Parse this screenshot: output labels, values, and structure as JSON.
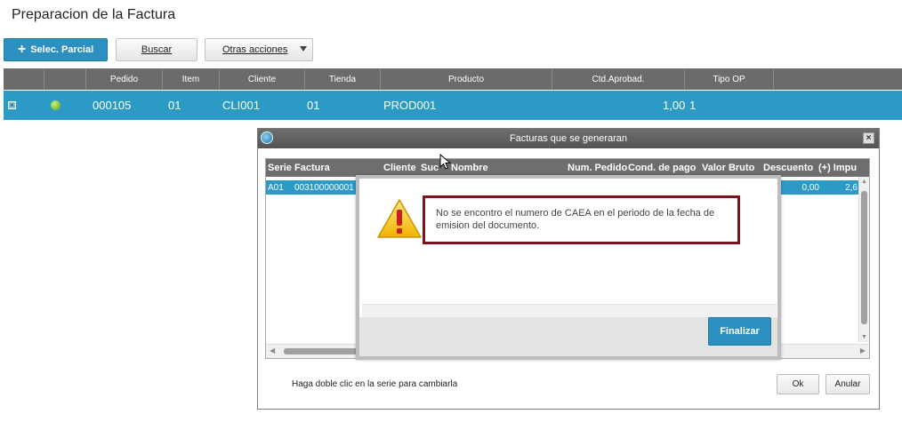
{
  "page": {
    "title": "Preparacion de la Factura"
  },
  "toolbar": {
    "selec_parcial": "Selec. Parcial",
    "buscar": "Buscar",
    "otras_acciones": "Otras acciones"
  },
  "main_grid": {
    "columns": [
      "Pedido",
      "Item",
      "Cliente",
      "Tienda",
      "Producto",
      "Ctd.Aprobad.",
      "Tipo OP"
    ],
    "row": {
      "pedido": "000105",
      "item": "01",
      "cliente": "CLI001",
      "tienda": "01",
      "producto": "PROD001",
      "ctd_aprobada": "1,00",
      "tipo_op": "1"
    }
  },
  "invoice_dialog": {
    "title": "Facturas que se generaran",
    "columns": [
      "Serie",
      "Factura",
      "Cliente",
      "Suc",
      "Nombre",
      "Num. Pedido",
      "Cond. de pago",
      "Valor Bruto",
      "Descuento",
      "(+) Impu"
    ],
    "row": {
      "serie": "A01",
      "factura": "003100000001",
      "descuento": "0,00",
      "impuesto": "2,6"
    },
    "hint": "Haga doble clic en la serie para cambiarla",
    "ok": "Ok",
    "anular": "Anular"
  },
  "alert": {
    "message": "No se encontro el numero de CAEA en el periodo de la fecha de emision del documento.",
    "finalizar": "Finalizar"
  },
  "colors": {
    "accent_blue": "#2b90bf",
    "row_selected": "#2b9ac4",
    "header_gray": "#6b6b6b",
    "highlight_border": "#7b1320",
    "status_green": "#58a81a"
  }
}
